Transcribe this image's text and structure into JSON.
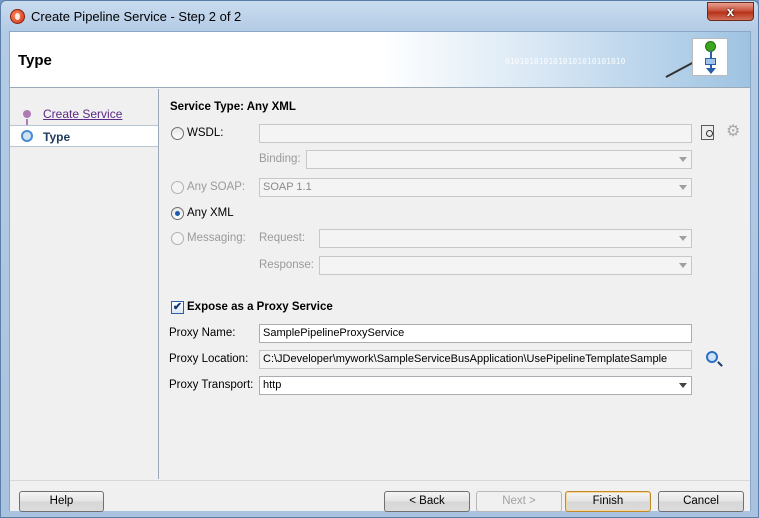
{
  "window": {
    "title": "Create Pipeline Service - Step 2 of 2",
    "close_glyph": "x"
  },
  "header": {
    "title": "Type",
    "decor_text": "0101010101010101010101010"
  },
  "nav": {
    "items": [
      {
        "label": "Create Service",
        "state": "visited"
      },
      {
        "label": "Type",
        "state": "current"
      }
    ]
  },
  "service_type": {
    "heading": "Service Type: Any XML",
    "wsdl_label": "WSDL:",
    "wsdl_value": "",
    "binding_label": "Binding:",
    "binding_value": "",
    "any_soap_label": "Any SOAP:",
    "any_soap_value": "SOAP 1.1",
    "any_xml_label": "Any XML",
    "messaging_label": "Messaging:",
    "request_label": "Request:",
    "request_value": "",
    "response_label": "Response:",
    "response_value": "",
    "selected": "Any XML"
  },
  "proxy": {
    "expose_label": "Expose as a Proxy Service",
    "expose_checked": true,
    "check_glyph": "✔",
    "name_label": "Proxy Name:",
    "name_value": "SamplePipelineProxyService",
    "location_label": "Proxy Location:",
    "location_value": "C:\\JDeveloper\\mywork\\SampleServiceBusApplication\\UsePipelineTemplateSample",
    "transport_label": "Proxy Transport:",
    "transport_value": "http"
  },
  "icons": {
    "gear": "⚙"
  },
  "footer": {
    "help": "Help",
    "back": "< Back",
    "next": "Next >",
    "finish": "Finish",
    "cancel": "Cancel"
  }
}
